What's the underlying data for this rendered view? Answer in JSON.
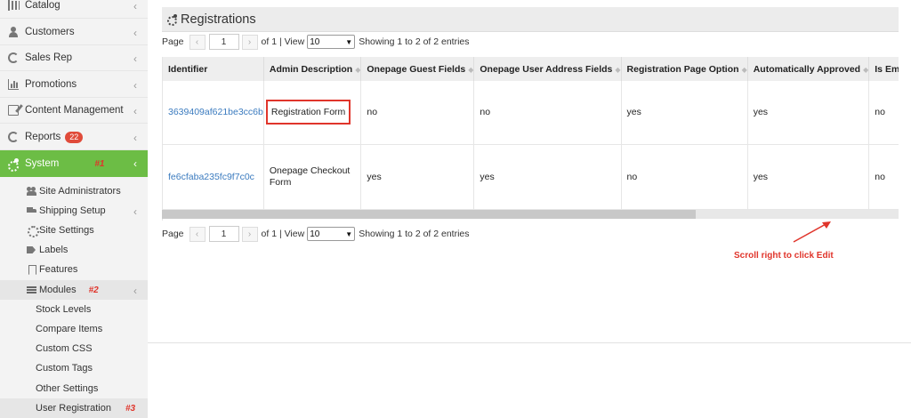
{
  "sidebar": {
    "items": [
      {
        "label": "Catalog",
        "icon": "bars-icon"
      },
      {
        "label": "Customers",
        "icon": "user-icon"
      },
      {
        "label": "Sales Rep",
        "icon": "refresh-icon"
      },
      {
        "label": "Promotions",
        "icon": "bar-chart-icon"
      },
      {
        "label": "Content Management",
        "icon": "edit-icon"
      },
      {
        "label": "Reports",
        "icon": "refresh-icon",
        "badge": "22"
      },
      {
        "label": "System",
        "icon": "gears-icon",
        "mark": "#1"
      }
    ],
    "system_sub": [
      {
        "label": "Site Administrators",
        "icon": "users-icon"
      },
      {
        "label": "Shipping Setup",
        "icon": "truck-icon"
      },
      {
        "label": "Site Settings",
        "icon": "gear-icon"
      },
      {
        "label": "Labels",
        "icon": "tag-icon"
      },
      {
        "label": "Features",
        "icon": "bookmark-icon"
      },
      {
        "label": "Modules",
        "icon": "list-icon",
        "mark": "#2"
      }
    ],
    "modules_sub": [
      {
        "label": "Stock Levels"
      },
      {
        "label": "Compare Items"
      },
      {
        "label": "Custom CSS"
      },
      {
        "label": "Custom Tags"
      },
      {
        "label": "Other Settings"
      },
      {
        "label": "User Registration",
        "mark": "#3"
      }
    ],
    "active_color": "#6cbd45"
  },
  "panel": {
    "title": "Registrations",
    "pager": {
      "page_label": "Page",
      "page_value": "1",
      "of_text": "of 1 | View",
      "view_value": "10",
      "showing_text": "Showing 1 to 2 of 2 entries"
    },
    "table": {
      "columns": [
        "Identifier",
        "Admin Description",
        "Onepage Guest Fields",
        "Onepage User Address Fields",
        "Registration Page Option",
        "Automatically Approved",
        "Is Email"
      ],
      "rows": [
        [
          "3639409af621be3cc6b",
          "Registration Form",
          "no",
          "no",
          "yes",
          "yes",
          "no"
        ],
        [
          "fe6cfaba235fc9f7c0c",
          "Onepage Checkout Form",
          "yes",
          "yes",
          "no",
          "yes",
          "no"
        ]
      ]
    },
    "annotation": "Scroll right to click Edit",
    "annotation_color": "#e0352b"
  }
}
